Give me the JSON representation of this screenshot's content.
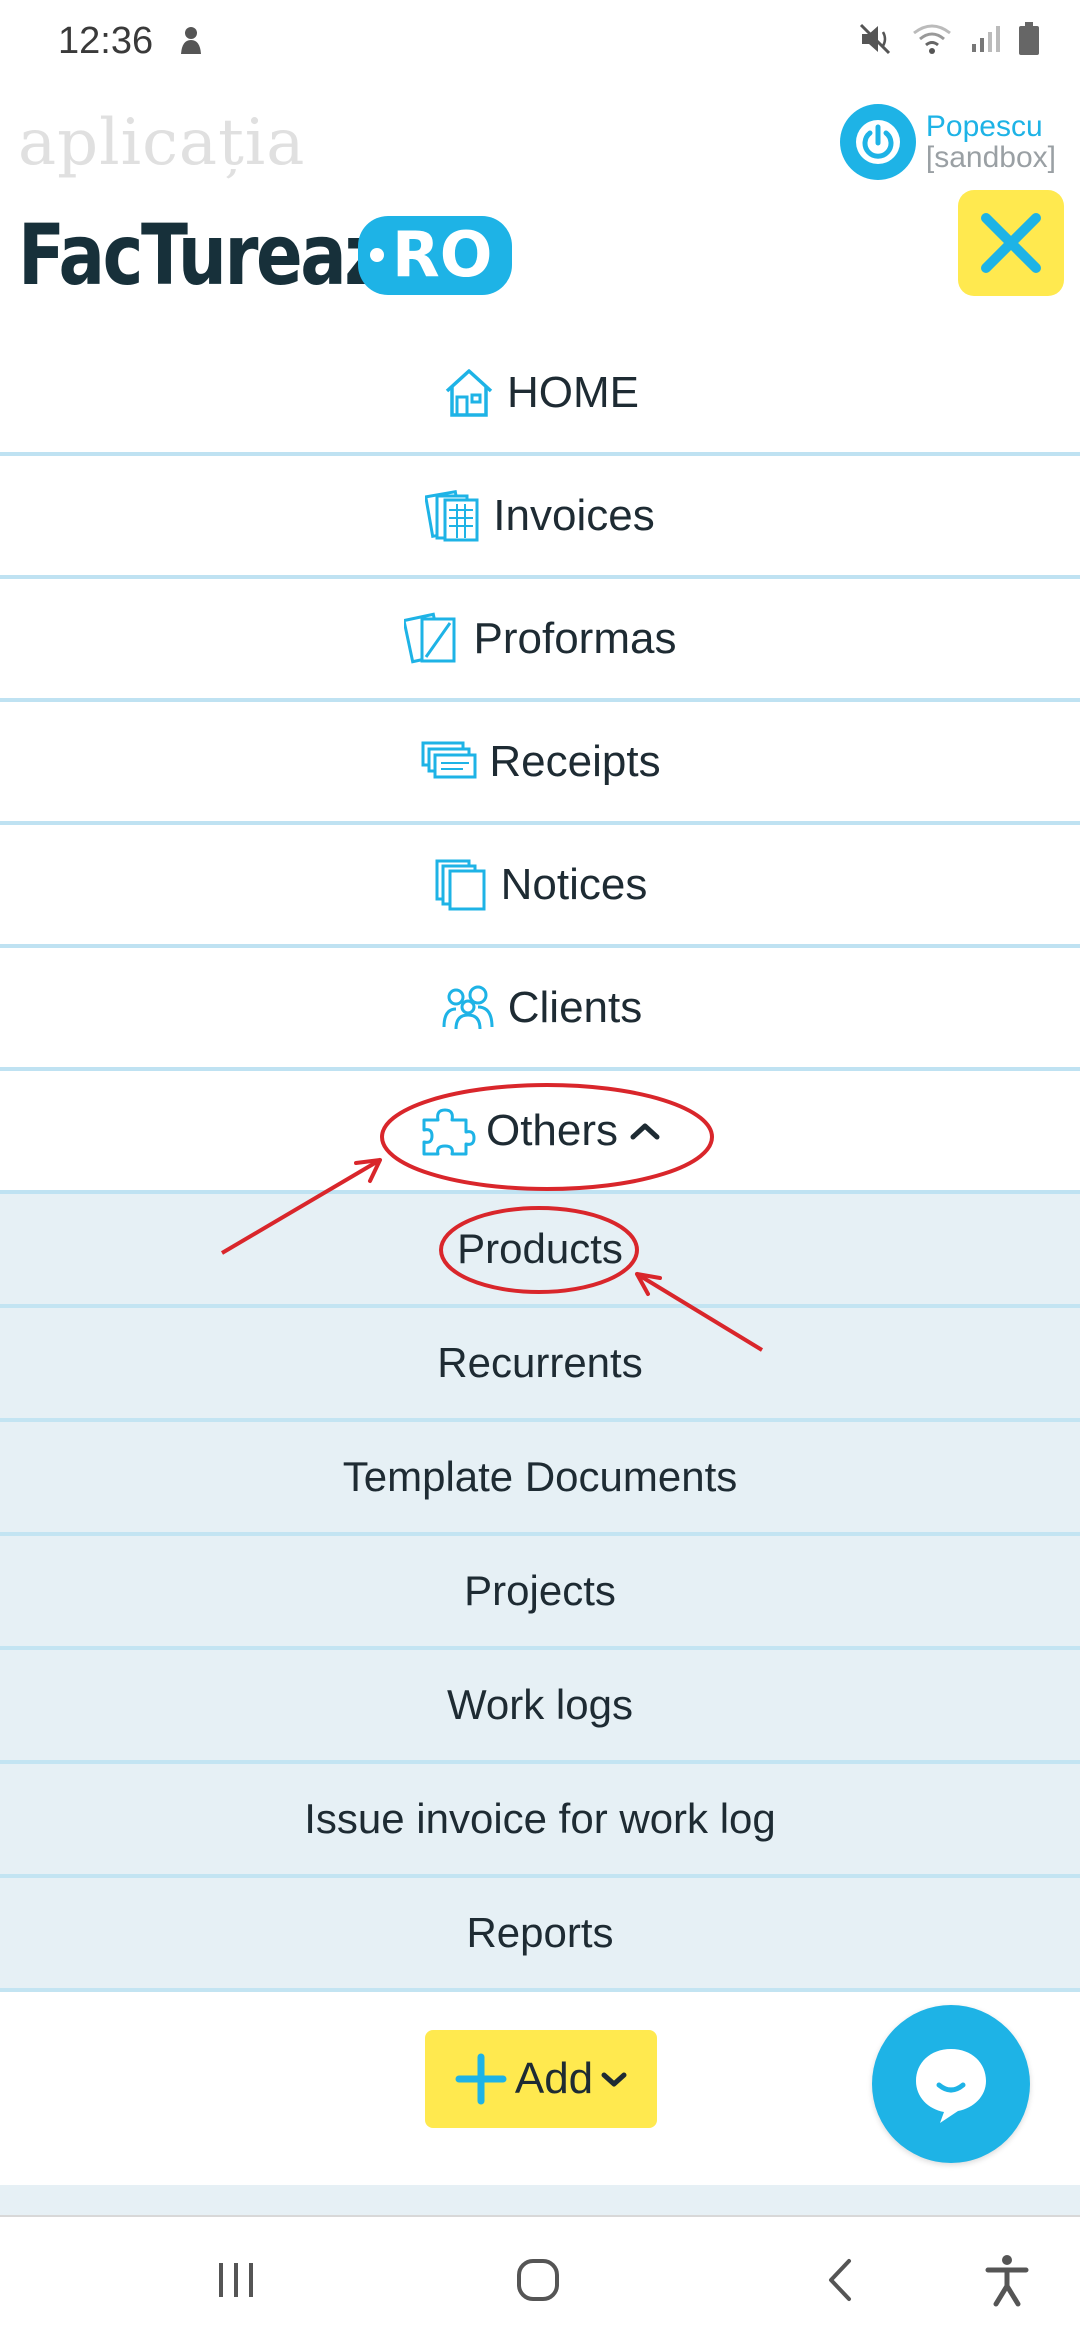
{
  "status_bar": {
    "time": "12:36"
  },
  "header": {
    "brand_small": "aplicația",
    "brand_main": "FacTurează",
    "brand_badge": "RO",
    "user_name": "Popescu",
    "user_sub": "[sandbox]"
  },
  "menu": {
    "items": [
      {
        "label": "HOME",
        "icon": "home-icon"
      },
      {
        "label": "Invoices",
        "icon": "invoices-icon"
      },
      {
        "label": "Proformas",
        "icon": "proformas-icon"
      },
      {
        "label": "Receipts",
        "icon": "receipts-icon"
      },
      {
        "label": "Notices",
        "icon": "notices-icon"
      },
      {
        "label": "Clients",
        "icon": "clients-icon"
      },
      {
        "label": "Others",
        "icon": "puzzle-icon"
      }
    ],
    "submenu": [
      "Products",
      "Recurrents",
      "Template Documents",
      "Projects",
      "Work logs",
      "Issue invoice for work log",
      "Reports"
    ]
  },
  "add_button": {
    "label": "Add"
  },
  "colors": {
    "accent": "#1eb3e6",
    "yellow": "#ffe94f",
    "dark": "#17303a",
    "submenu_bg": "#e6f0f5",
    "divider": "#bfe2f2",
    "annotation": "#d9262b"
  }
}
